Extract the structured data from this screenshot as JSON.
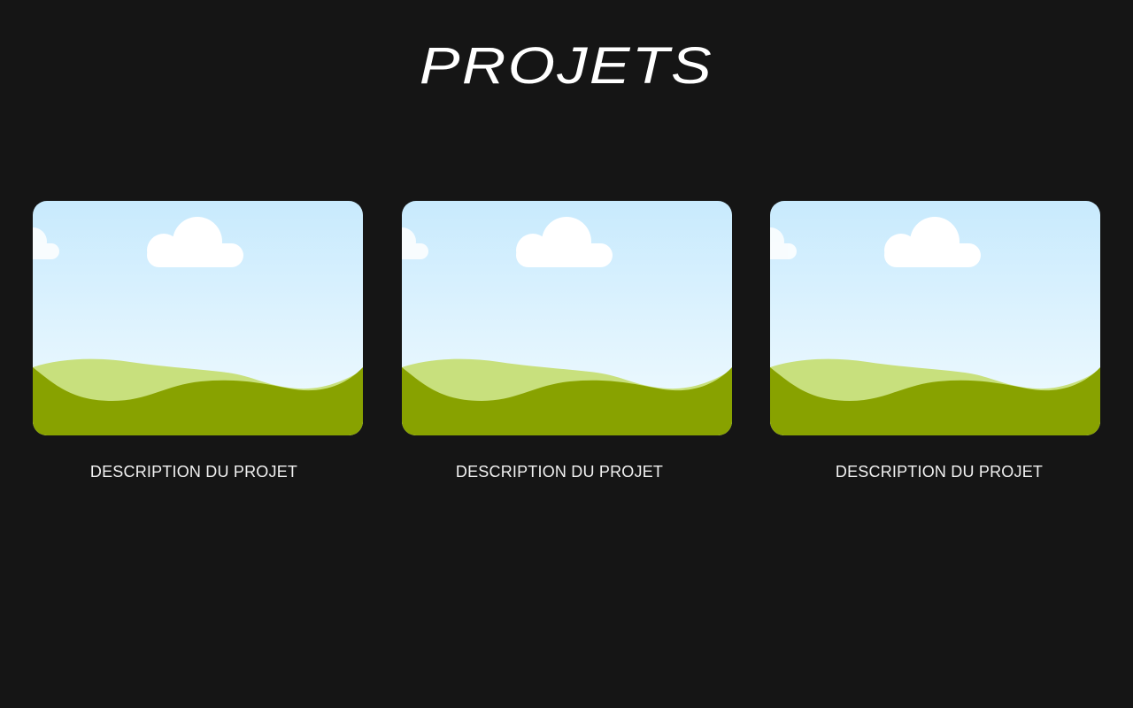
{
  "page": {
    "title": "PROJETS"
  },
  "projects": [
    {
      "description": "DESCRIPTION DU PROJET",
      "image_icon": "landscape-image-placeholder"
    },
    {
      "description": "DESCRIPTION DU PROJET",
      "image_icon": "landscape-image-placeholder"
    },
    {
      "description": "DESCRIPTION DU PROJET",
      "image_icon": "landscape-image-placeholder"
    }
  ],
  "colors": {
    "background": "#151515",
    "text": "#ffffff",
    "sky_top": "#c8eafd",
    "sky_bottom": "#f2fbff",
    "hill_light": "#c8e07d",
    "hill_dark": "#88a200",
    "cloud": "#ffffff"
  }
}
